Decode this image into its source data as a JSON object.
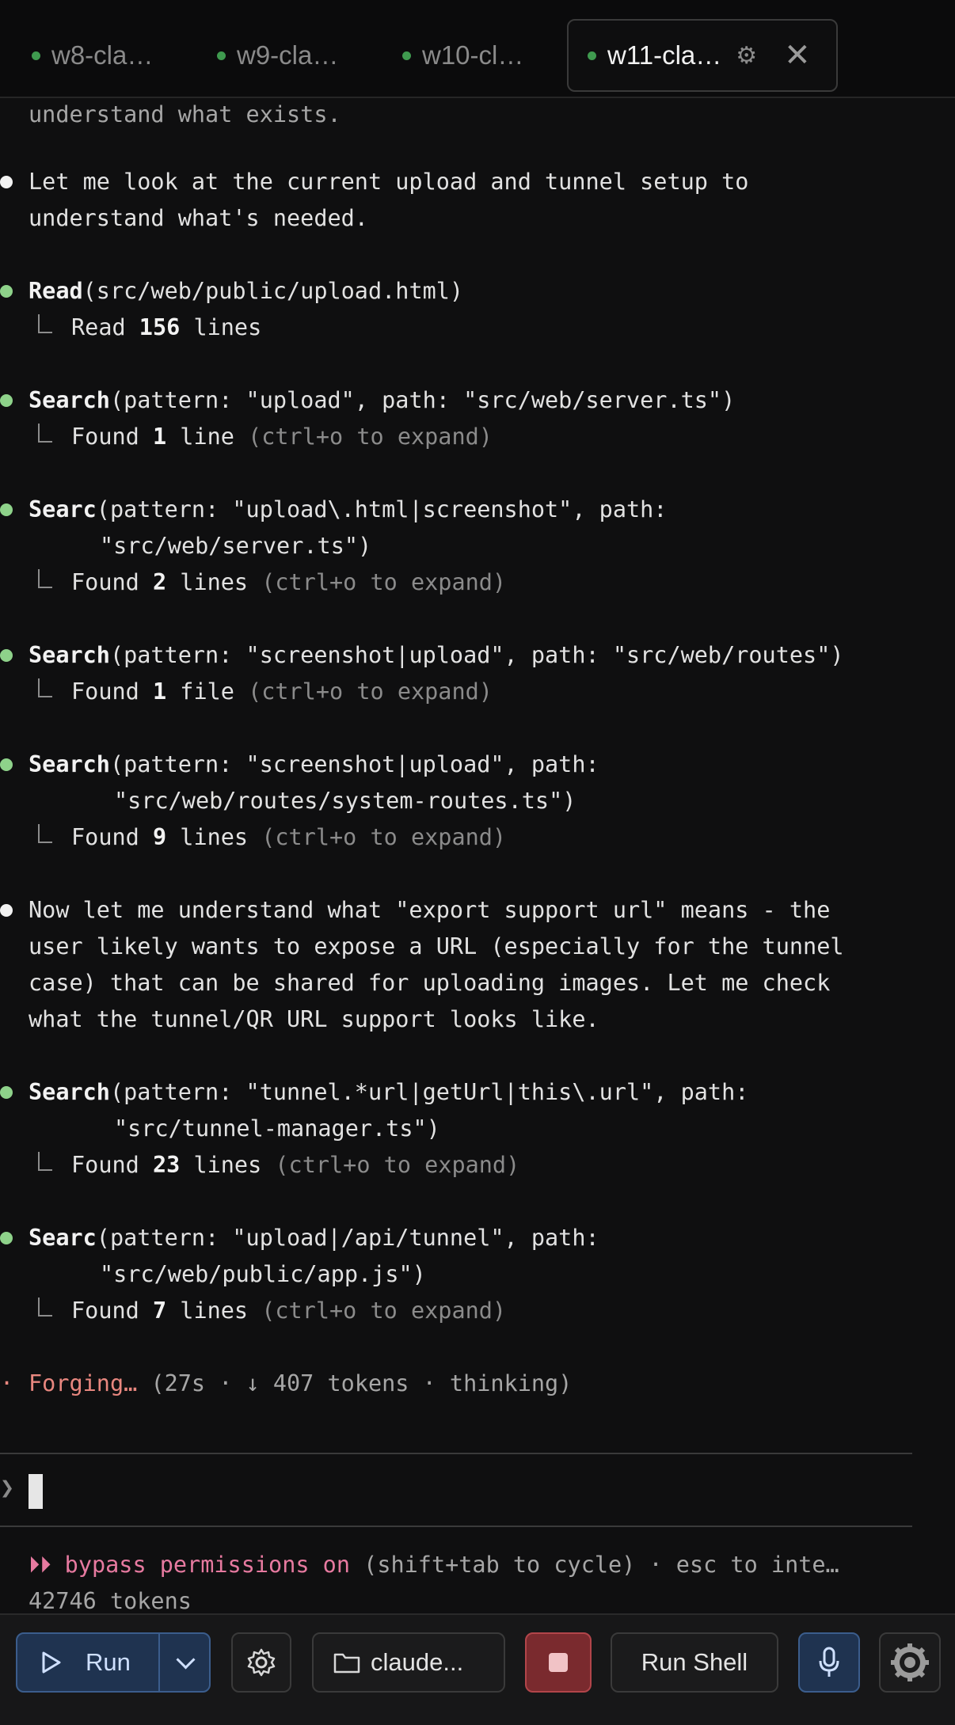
{
  "tabs": [
    {
      "label": "w8-cla…"
    },
    {
      "label": "w9-cla…"
    },
    {
      "label": "w10-cl…"
    },
    {
      "label": "w11-cla…",
      "active": true
    }
  ],
  "transcript": {
    "top_fade": "understand what exists.",
    "msg1": [
      "Let me look at the current upload and tunnel setup to",
      "understand what's needed."
    ],
    "tool1": {
      "name": "Read",
      "args": "(src/web/public/upload.html)",
      "res_a": "Read ",
      "res_num": "156",
      "res_b": " lines"
    },
    "tool2": {
      "name": "Search",
      "args": "(pattern: \"upload\", path: \"src/web/server.ts\")",
      "res_a": "Found ",
      "res_num": "1",
      "res_b": " line ",
      "hint": "(ctrl+o to expand)"
    },
    "tool3": {
      "name": "Searc",
      "args": "(pattern: \"upload\\.html|screenshot\", path:",
      "cont": "\"src/web/server.ts\")",
      "res_a": "Found ",
      "res_num": "2",
      "res_b": " lines ",
      "hint": "(ctrl+o to expand)"
    },
    "tool4": {
      "name": "Search",
      "args": "(pattern: \"screenshot|upload\", path: \"src/web/routes\")",
      "res_a": "Found ",
      "res_num": "1",
      "res_b": " file ",
      "hint": "(ctrl+o to expand)"
    },
    "tool5": {
      "name": "Search",
      "args": "(pattern: \"screenshot|upload\", path:",
      "cont": "\"src/web/routes/system-routes.ts\")",
      "res_a": "Found ",
      "res_num": "9",
      "res_b": " lines ",
      "hint": "(ctrl+o to expand)"
    },
    "msg2": [
      "Now let me understand what \"export support url\" means - the",
      "user likely wants to expose a URL (especially for the tunnel",
      "case) that can be shared for uploading images. Let me check",
      "what the tunnel/QR URL support looks like."
    ],
    "tool6": {
      "name": "Search",
      "args": "(pattern: \"tunnel.*url|getUrl|this\\.url\", path:",
      "cont": "\"src/tunnel-manager.ts\")",
      "res_a": "Found ",
      "res_num": "23",
      "res_b": " lines ",
      "hint": "(ctrl+o to expand)"
    },
    "tool7": {
      "name": "Searc",
      "args": "(pattern: \"upload|/api/tunnel\", path:",
      "cont": "\"src/web/public/app.js\")",
      "res_a": "Found ",
      "res_num": "7",
      "res_b": " lines ",
      "hint": "(ctrl+o to expand)"
    },
    "status": {
      "bullet": "·",
      "verb": "Forging…",
      "detail": " (27s · ↓ 407 tokens · thinking)"
    }
  },
  "prompt": {
    "caret": "❯"
  },
  "footer": {
    "mode": "⏵⏵ bypass permissions on",
    "mode_hint": " (shift+tab to cycle) · esc to inte…",
    "tokens": "42746 tokens"
  },
  "toolbar": {
    "run_label": "Run",
    "folder_label": "claude...",
    "shell_label": "Run Shell"
  },
  "icons": {
    "tab_gear": "gear-icon",
    "tab_close": "close-icon",
    "run": "play-icon",
    "dropdown": "chevron-down-icon",
    "settings": "gear-icon",
    "folder": "folder-icon",
    "stop": "stop-icon",
    "mic": "microphone-icon",
    "settings_large": "gear-icon"
  },
  "colors": {
    "background": "#0f0f10",
    "tool_bullet": "#8ed28a",
    "status_accent": "#e8877f",
    "mode_accent": "#e77aa0",
    "run_button": "#1f3350",
    "stop_button": "#7a2a2e"
  }
}
